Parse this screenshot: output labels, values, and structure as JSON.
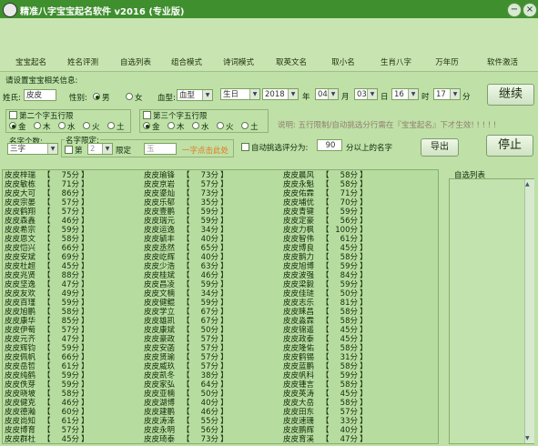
{
  "window": {
    "title": "精准八字宝宝起名软件 v2016 (专业版)",
    "minimize": "−",
    "close": "×"
  },
  "toolbar": [
    {
      "label": "宝宝起名",
      "icon": "baby-face-icon",
      "color": "#f3b36e"
    },
    {
      "label": "姓名评测",
      "icon": "bear-icon",
      "color": "#e79a4a"
    },
    {
      "label": "自选列表",
      "icon": "book-list-icon",
      "color": "#4aa0d8"
    },
    {
      "label": "组合模式",
      "icon": "lantern-icon",
      "color": "#d63a2a"
    },
    {
      "label": "诗词模式",
      "icon": "open-book-icon",
      "color": "#f1c640"
    },
    {
      "label": "取英文名",
      "icon": "lion-mask-icon",
      "color": "#e04a3a"
    },
    {
      "label": "取小名",
      "icon": "monkey-icon",
      "color": "#c5582c"
    },
    {
      "label": "生肖八字",
      "icon": "taiji-icon",
      "color": "#2a6fc9"
    },
    {
      "label": "万年历",
      "icon": "calendar-365-icon",
      "color": "#2a7bd0"
    },
    {
      "label": "软件激活",
      "icon": "power-icon",
      "color": "#c4242a"
    }
  ],
  "form": {
    "section_title": "请设置宝宝相关信息:",
    "surname_label": "姓氏:",
    "surname_value": "皮皮",
    "gender_label": "性别:",
    "male": "男",
    "female": "女",
    "blood_label": "血型:",
    "blood_value": "血型",
    "birth_select": "生日",
    "year_value": "2018",
    "year_unit": "年",
    "month_value": "04",
    "month_unit": "月",
    "day_value": "03",
    "day_unit": "日",
    "hour_value": "16",
    "hour_unit": "时",
    "minute_value": "17",
    "minute_unit": "分",
    "continue_button": "继续",
    "second_char_label": "第二个字五行限",
    "third_char_label": "第三个字五行限",
    "elements": [
      "金",
      "木",
      "水",
      "火",
      "土"
    ],
    "note": "说明: 五行限制/自动挑选分行需在『宝宝起名』下才生效! ! ! ! !",
    "name_count_label": "名字个数:",
    "name_count_value": "三字",
    "name_limit_label": "名字限定:",
    "limit_first_prefix": "第",
    "limit_position_value": "2",
    "limit_suffix": "限定",
    "limit_char_value": "玉",
    "limit_hint": "一字点击此处",
    "auto_pick_label": "自动挑选评分为:",
    "score_value": "90",
    "score_suffix": "分以上的名字",
    "export_button": "导出",
    "stop_button": "停止",
    "selected_list_label": "自选列表"
  },
  "results": {
    "col1": [
      [
        "皮皮梓瑞",
        "75分"
      ],
      [
        "皮皮敏栋",
        "71分"
      ],
      [
        "皮皮大可",
        "86分"
      ],
      [
        "皮皮宗晏",
        "57分"
      ],
      [
        "皮皮鹤翔",
        "57分"
      ],
      [
        "皮皮森鑫",
        "46分"
      ],
      [
        "皮皮希宗",
        "59分"
      ],
      [
        "皮皮恩文",
        "58分"
      ],
      [
        "皮皮恺兴",
        "66分"
      ],
      [
        "皮皮安斌",
        "69分"
      ],
      [
        "皮皮杜超",
        "45分"
      ],
      [
        "皮皮兆贤",
        "88分"
      ],
      [
        "皮皮坚逸",
        "47分"
      ],
      [
        "皮皮友欢",
        "49分"
      ],
      [
        "皮皮百瑾",
        "59分"
      ],
      [
        "皮皮旭鹏",
        "58分"
      ],
      [
        "皮皮康华",
        "85分"
      ],
      [
        "皮皮伊萄",
        "57分"
      ],
      [
        "皮皮元齐",
        "47分"
      ],
      [
        "皮皮辉钧",
        "59分"
      ],
      [
        "皮皮佩帆",
        "66分"
      ],
      [
        "皮皮岳哲",
        "61分"
      ],
      [
        "皮皮纯鹤",
        "59分"
      ],
      [
        "皮皮佚芽",
        "59分"
      ],
      [
        "皮皮晓坡",
        "58分"
      ],
      [
        "皮皮健克",
        "46分"
      ],
      [
        "皮皮德瀚",
        "60分"
      ],
      [
        "皮皮尚知",
        "61分"
      ],
      [
        "皮皮博育",
        "57分"
      ],
      [
        "皮皮群杜",
        "45分"
      ]
    ],
    "col2": [
      [
        "皮皮瑜锋",
        "73分"
      ],
      [
        "皮皮京岩",
        "57分"
      ],
      [
        "皮皮鎏灿",
        "73分"
      ],
      [
        "皮皮乐郁",
        "35分"
      ],
      [
        "皮皮壹鹏",
        "59分"
      ],
      [
        "皮皮瑞元",
        "59分"
      ],
      [
        "皮皮运逸",
        "34分"
      ],
      [
        "皮皮毓丰",
        "40分"
      ],
      [
        "皮皮丞然",
        "65分"
      ],
      [
        "皮皮屹辉",
        "40分"
      ],
      [
        "皮皮少浩",
        "63分"
      ],
      [
        "皮皮桂斌",
        "46分"
      ],
      [
        "皮皮昌凌",
        "59分"
      ],
      [
        "皮皮文楠",
        "34分"
      ],
      [
        "皮皮健鲲",
        "59分"
      ],
      [
        "皮皮学立",
        "67分"
      ],
      [
        "皮皮雄凯",
        "67分"
      ],
      [
        "皮皮康斌",
        "50分"
      ],
      [
        "皮皮豪政",
        "57分"
      ],
      [
        "皮皮安菡",
        "57分"
      ],
      [
        "皮皮贤瑜",
        "57分"
      ],
      [
        "皮皮威玖",
        "57分"
      ],
      [
        "皮皮凯冬",
        "38分"
      ],
      [
        "皮皮家弘",
        "64分"
      ],
      [
        "皮皮亚楠",
        "50分"
      ],
      [
        "皮皮湖博",
        "40分"
      ],
      [
        "皮皮建鹏",
        "46分"
      ],
      [
        "皮皮涛泽",
        "55分"
      ],
      [
        "皮皮永明",
        "56分"
      ],
      [
        "皮皮琦泰",
        "73分"
      ]
    ],
    "col3": [
      [
        "皮皮晨风",
        "58分"
      ],
      [
        "皮皮永魁",
        "58分"
      ],
      [
        "皮皮佑霖",
        "71分"
      ],
      [
        "皮皮埔优",
        "70分"
      ],
      [
        "皮皮青键",
        "59分"
      ],
      [
        "皮皮定豪",
        "56分"
      ],
      [
        "皮皮力枫",
        "100分"
      ],
      [
        "皮皮智伟",
        "61分"
      ],
      [
        "皮皮博良",
        "45分"
      ],
      [
        "皮皮鹅力",
        "58分"
      ],
      [
        "皮皮旭博",
        "59分"
      ],
      [
        "皮皮波强",
        "84分"
      ],
      [
        "皮皮梁毅",
        "59分"
      ],
      [
        "皮皮佳琏",
        "50分"
      ],
      [
        "皮皮志乐",
        "81分"
      ],
      [
        "皮皮睐昌",
        "58分"
      ],
      [
        "皮皮淼霖",
        "58分"
      ],
      [
        "皮皮锦遥",
        "45分"
      ],
      [
        "皮皮政泰",
        "45分"
      ],
      [
        "皮皮隆佑",
        "58分"
      ],
      [
        "皮皮鹤锡",
        "31分"
      ],
      [
        "皮皮蓝鹏",
        "58分"
      ],
      [
        "皮皮帆科",
        "59分"
      ],
      [
        "皮皮锺言",
        "58分"
      ],
      [
        "皮皮英涛",
        "45分"
      ],
      [
        "皮皮大岳",
        "58分"
      ],
      [
        "皮皮田东",
        "57分"
      ],
      [
        "皮皮速珊",
        "33分"
      ],
      [
        "皮皮鹏辉",
        "40分"
      ],
      [
        "皮皮育溪",
        "47分"
      ]
    ]
  }
}
